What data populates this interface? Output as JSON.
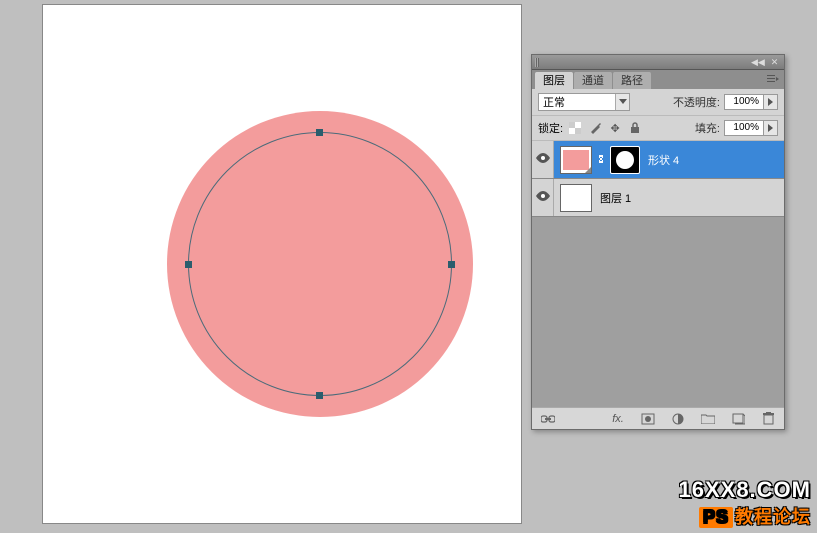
{
  "canvas": {
    "shape_color": "#f39c9c"
  },
  "panel": {
    "tabs": [
      {
        "label": "图层"
      },
      {
        "label": "通道"
      },
      {
        "label": "路径"
      }
    ],
    "blend_mode": "正常",
    "opacity_label": "不透明度:",
    "opacity_value": "100%",
    "lock_label": "锁定:",
    "fill_label": "填充:",
    "fill_value": "100%",
    "layers": [
      {
        "name": "形状 4"
      },
      {
        "name": "图层 1"
      }
    ],
    "fx_label": "fx."
  },
  "watermark": {
    "line1": "16XX8.COM",
    "line2_prefix": "PS",
    "line2_rest": "教程论坛"
  }
}
